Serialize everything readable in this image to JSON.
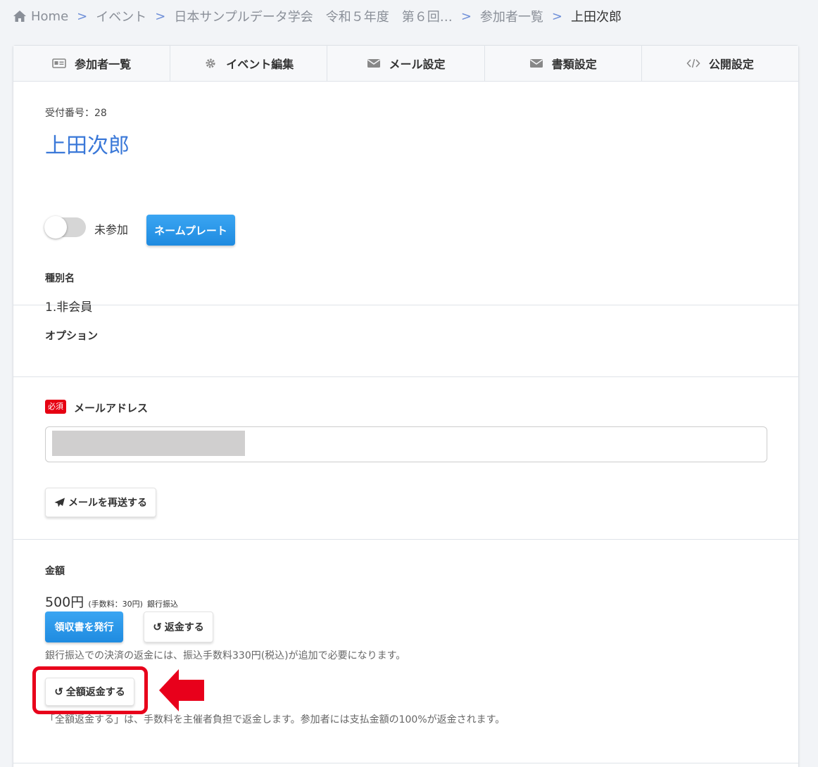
{
  "breadcrumb": {
    "home": "Home",
    "items": [
      "イベント",
      "日本サンプルデータ学会　令和５年度　第６回…",
      "参加者一覧",
      "上田次郎"
    ]
  },
  "tabs": [
    {
      "label": "参加者一覧",
      "icon": "id-card-icon"
    },
    {
      "label": "イベント編集",
      "icon": "gear-icon"
    },
    {
      "label": "メール設定",
      "icon": "envelope-icon"
    },
    {
      "label": "書類設定",
      "icon": "envelope-icon"
    },
    {
      "label": "公開設定",
      "icon": "code-icon"
    }
  ],
  "participant": {
    "reception": "受付番号：28",
    "name": "上田次郎",
    "attendance_label": "未参加",
    "nameplate_button": "ネームプレート"
  },
  "category": {
    "label": "種別名",
    "value": "1.非会員"
  },
  "options": {
    "label": "オプション"
  },
  "email": {
    "required": "必須",
    "label": "メールアドレス",
    "resend_button": "メールを再送する"
  },
  "payment": {
    "label": "金額",
    "amount": "500円",
    "fee": "(手数料：30円)",
    "method": "銀行振込",
    "receipt_button": "領収書を発行",
    "refund_button": "返金する",
    "refund_note": "銀行振込での決済の返金には、振込手数料330円(税込)が追加で必要になります。",
    "full_refund_button": "全額返金する",
    "full_refund_note": "「全額返金する」は、手数料を主催者負担で返金します。参加者には支払金額の100%が返金されます。"
  },
  "colors": {
    "accent": "#3a78d8",
    "primary": "#2196f3",
    "required": "#e60012",
    "highlight": "#e8001b"
  }
}
